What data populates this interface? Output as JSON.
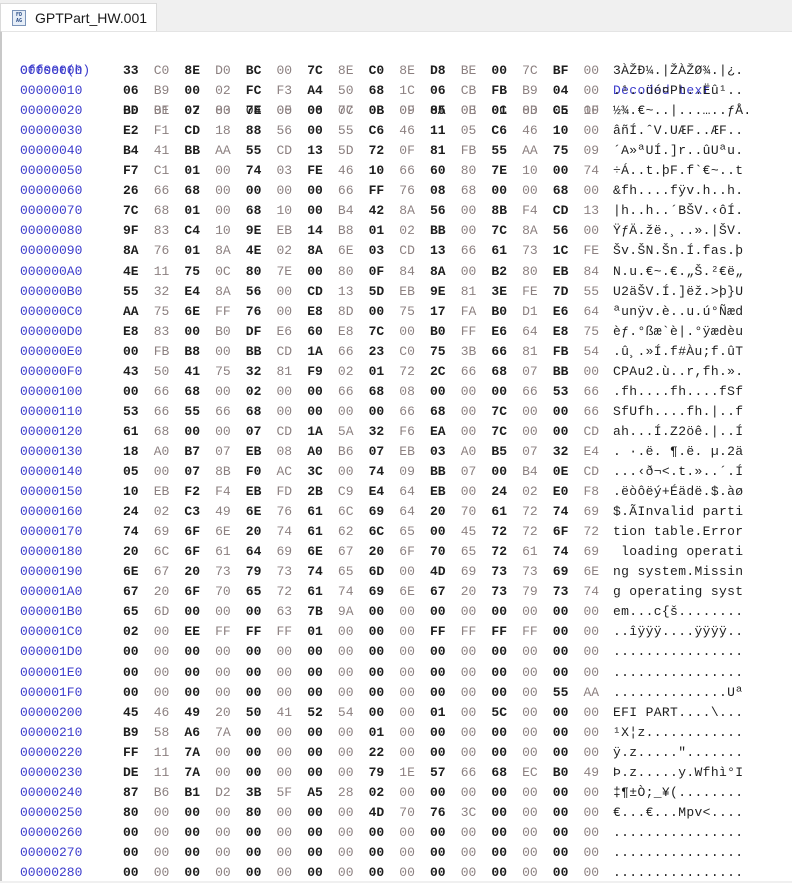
{
  "tab": {
    "title": "GPTPart_HW.001",
    "icon": "hex-file-icon",
    "icon_text": "FD AG"
  },
  "header": {
    "offset_label": "Offset(h)",
    "columns": [
      "00",
      "01",
      "02",
      "03",
      "04",
      "05",
      "06",
      "07",
      "08",
      "09",
      "0A",
      "0B",
      "0C",
      "0D",
      "0E",
      "0F"
    ],
    "decoded_label": "Decoded text"
  },
  "colors": {
    "offset": "#3c3ccc",
    "byte_even": "#1e1e1e",
    "byte_odd": "#8c8080"
  },
  "rows": [
    {
      "offset": "00000000",
      "bytes": [
        "33",
        "C0",
        "8E",
        "D0",
        "BC",
        "00",
        "7C",
        "8E",
        "C0",
        "8E",
        "D8",
        "BE",
        "00",
        "7C",
        "BF",
        "00"
      ],
      "text": "3ÀŽÐ¼.|ŽÀŽØ¾.|¿."
    },
    {
      "offset": "00000010",
      "bytes": [
        "06",
        "B9",
        "00",
        "02",
        "FC",
        "F3",
        "A4",
        "50",
        "68",
        "1C",
        "06",
        "CB",
        "FB",
        "B9",
        "04",
        "00"
      ],
      "text": ".¹..üó¤Ph..Ëû¹.."
    },
    {
      "offset": "00000020",
      "bytes": [
        "BD",
        "BE",
        "07",
        "80",
        "7E",
        "00",
        "00",
        "7C",
        "0B",
        "0F",
        "85",
        "0E",
        "01",
        "83",
        "C5",
        "10"
      ],
      "text": "½¾.€~..|...…..ƒÅ."
    },
    {
      "offset": "00000030",
      "bytes": [
        "E2",
        "F1",
        "CD",
        "18",
        "88",
        "56",
        "00",
        "55",
        "C6",
        "46",
        "11",
        "05",
        "C6",
        "46",
        "10",
        "00"
      ],
      "text": "âñÍ.ˆV.UÆF..ÆF.."
    },
    {
      "offset": "00000040",
      "bytes": [
        "B4",
        "41",
        "BB",
        "AA",
        "55",
        "CD",
        "13",
        "5D",
        "72",
        "0F",
        "81",
        "FB",
        "55",
        "AA",
        "75",
        "09"
      ],
      "text": "´A»ªUÍ.]r..ûUªu."
    },
    {
      "offset": "00000050",
      "bytes": [
        "F7",
        "C1",
        "01",
        "00",
        "74",
        "03",
        "FE",
        "46",
        "10",
        "66",
        "60",
        "80",
        "7E",
        "10",
        "00",
        "74"
      ],
      "text": "÷Á..t.þF.f`€~..t"
    },
    {
      "offset": "00000060",
      "bytes": [
        "26",
        "66",
        "68",
        "00",
        "00",
        "00",
        "00",
        "66",
        "FF",
        "76",
        "08",
        "68",
        "00",
        "00",
        "68",
        "00"
      ],
      "text": "&fh....fÿv.h..h."
    },
    {
      "offset": "00000070",
      "bytes": [
        "7C",
        "68",
        "01",
        "00",
        "68",
        "10",
        "00",
        "B4",
        "42",
        "8A",
        "56",
        "00",
        "8B",
        "F4",
        "CD",
        "13"
      ],
      "text": "|h..h..´BŠV.‹ôÍ."
    },
    {
      "offset": "00000080",
      "bytes": [
        "9F",
        "83",
        "C4",
        "10",
        "9E",
        "EB",
        "14",
        "B8",
        "01",
        "02",
        "BB",
        "00",
        "7C",
        "8A",
        "56",
        "00"
      ],
      "text": "ŸƒÄ.žë.¸..».|ŠV."
    },
    {
      "offset": "00000090",
      "bytes": [
        "8A",
        "76",
        "01",
        "8A",
        "4E",
        "02",
        "8A",
        "6E",
        "03",
        "CD",
        "13",
        "66",
        "61",
        "73",
        "1C",
        "FE"
      ],
      "text": "Šv.ŠN.Šn.Í.fas.þ"
    },
    {
      "offset": "000000A0",
      "bytes": [
        "4E",
        "11",
        "75",
        "0C",
        "80",
        "7E",
        "00",
        "80",
        "0F",
        "84",
        "8A",
        "00",
        "B2",
        "80",
        "EB",
        "84"
      ],
      "text": "N.u.€~.€.„Š.²€ë„"
    },
    {
      "offset": "000000B0",
      "bytes": [
        "55",
        "32",
        "E4",
        "8A",
        "56",
        "00",
        "CD",
        "13",
        "5D",
        "EB",
        "9E",
        "81",
        "3E",
        "FE",
        "7D",
        "55"
      ],
      "text": "U2äŠV.Í.]ëž.>þ}U"
    },
    {
      "offset": "000000C0",
      "bytes": [
        "AA",
        "75",
        "6E",
        "FF",
        "76",
        "00",
        "E8",
        "8D",
        "00",
        "75",
        "17",
        "FA",
        "B0",
        "D1",
        "E6",
        "64"
      ],
      "text": "ªunÿv.è..u.ú°Ñæd"
    },
    {
      "offset": "000000D0",
      "bytes": [
        "E8",
        "83",
        "00",
        "B0",
        "DF",
        "E6",
        "60",
        "E8",
        "7C",
        "00",
        "B0",
        "FF",
        "E6",
        "64",
        "E8",
        "75"
      ],
      "text": "èƒ.°ßæ`è|.°ÿædèu"
    },
    {
      "offset": "000000E0",
      "bytes": [
        "00",
        "FB",
        "B8",
        "00",
        "BB",
        "CD",
        "1A",
        "66",
        "23",
        "C0",
        "75",
        "3B",
        "66",
        "81",
        "FB",
        "54"
      ],
      "text": ".û¸.»Í.f#Àu;f.ûT"
    },
    {
      "offset": "000000F0",
      "bytes": [
        "43",
        "50",
        "41",
        "75",
        "32",
        "81",
        "F9",
        "02",
        "01",
        "72",
        "2C",
        "66",
        "68",
        "07",
        "BB",
        "00"
      ],
      "text": "CPAu2.ù..r,fh.»."
    },
    {
      "offset": "00000100",
      "bytes": [
        "00",
        "66",
        "68",
        "00",
        "02",
        "00",
        "00",
        "66",
        "68",
        "08",
        "00",
        "00",
        "00",
        "66",
        "53",
        "66"
      ],
      "text": ".fh....fh....fSf"
    },
    {
      "offset": "00000110",
      "bytes": [
        "53",
        "66",
        "55",
        "66",
        "68",
        "00",
        "00",
        "00",
        "00",
        "66",
        "68",
        "00",
        "7C",
        "00",
        "00",
        "66"
      ],
      "text": "SfUfh....fh.|..f"
    },
    {
      "offset": "00000120",
      "bytes": [
        "61",
        "68",
        "00",
        "00",
        "07",
        "CD",
        "1A",
        "5A",
        "32",
        "F6",
        "EA",
        "00",
        "7C",
        "00",
        "00",
        "CD"
      ],
      "text": "ah...Í.Z2öê.|..Í"
    },
    {
      "offset": "00000130",
      "bytes": [
        "18",
        "A0",
        "B7",
        "07",
        "EB",
        "08",
        "A0",
        "B6",
        "07",
        "EB",
        "03",
        "A0",
        "B5",
        "07",
        "32",
        "E4"
      ],
      "text": ". ·.ë. ¶.ë. µ.2ä"
    },
    {
      "offset": "00000140",
      "bytes": [
        "05",
        "00",
        "07",
        "8B",
        "F0",
        "AC",
        "3C",
        "00",
        "74",
        "09",
        "BB",
        "07",
        "00",
        "B4",
        "0E",
        "CD"
      ],
      "text": "...‹ð¬<.t.»..´.Í"
    },
    {
      "offset": "00000150",
      "bytes": [
        "10",
        "EB",
        "F2",
        "F4",
        "EB",
        "FD",
        "2B",
        "C9",
        "E4",
        "64",
        "EB",
        "00",
        "24",
        "02",
        "E0",
        "F8"
      ],
      "text": ".ëòôëý+Éädë.$.àø"
    },
    {
      "offset": "00000160",
      "bytes": [
        "24",
        "02",
        "C3",
        "49",
        "6E",
        "76",
        "61",
        "6C",
        "69",
        "64",
        "20",
        "70",
        "61",
        "72",
        "74",
        "69"
      ],
      "text": "$.ÃInvalid parti"
    },
    {
      "offset": "00000170",
      "bytes": [
        "74",
        "69",
        "6F",
        "6E",
        "20",
        "74",
        "61",
        "62",
        "6C",
        "65",
        "00",
        "45",
        "72",
        "72",
        "6F",
        "72"
      ],
      "text": "tion table.Error"
    },
    {
      "offset": "00000180",
      "bytes": [
        "20",
        "6C",
        "6F",
        "61",
        "64",
        "69",
        "6E",
        "67",
        "20",
        "6F",
        "70",
        "65",
        "72",
        "61",
        "74",
        "69"
      ],
      "text": " loading operati"
    },
    {
      "offset": "00000190",
      "bytes": [
        "6E",
        "67",
        "20",
        "73",
        "79",
        "73",
        "74",
        "65",
        "6D",
        "00",
        "4D",
        "69",
        "73",
        "73",
        "69",
        "6E"
      ],
      "text": "ng system.Missin"
    },
    {
      "offset": "000001A0",
      "bytes": [
        "67",
        "20",
        "6F",
        "70",
        "65",
        "72",
        "61",
        "74",
        "69",
        "6E",
        "67",
        "20",
        "73",
        "79",
        "73",
        "74"
      ],
      "text": "g operating syst"
    },
    {
      "offset": "000001B0",
      "bytes": [
        "65",
        "6D",
        "00",
        "00",
        "00",
        "63",
        "7B",
        "9A",
        "00",
        "00",
        "00",
        "00",
        "00",
        "00",
        "00",
        "00"
      ],
      "text": "em...c{š........"
    },
    {
      "offset": "000001C0",
      "bytes": [
        "02",
        "00",
        "EE",
        "FF",
        "FF",
        "FF",
        "01",
        "00",
        "00",
        "00",
        "FF",
        "FF",
        "FF",
        "FF",
        "00",
        "00"
      ],
      "text": "..îÿÿÿ....ÿÿÿÿ.."
    },
    {
      "offset": "000001D0",
      "bytes": [
        "00",
        "00",
        "00",
        "00",
        "00",
        "00",
        "00",
        "00",
        "00",
        "00",
        "00",
        "00",
        "00",
        "00",
        "00",
        "00"
      ],
      "text": "................"
    },
    {
      "offset": "000001E0",
      "bytes": [
        "00",
        "00",
        "00",
        "00",
        "00",
        "00",
        "00",
        "00",
        "00",
        "00",
        "00",
        "00",
        "00",
        "00",
        "00",
        "00"
      ],
      "text": "................"
    },
    {
      "offset": "000001F0",
      "bytes": [
        "00",
        "00",
        "00",
        "00",
        "00",
        "00",
        "00",
        "00",
        "00",
        "00",
        "00",
        "00",
        "00",
        "00",
        "55",
        "AA"
      ],
      "text": "..............Uª"
    },
    {
      "offset": "00000200",
      "bytes": [
        "45",
        "46",
        "49",
        "20",
        "50",
        "41",
        "52",
        "54",
        "00",
        "00",
        "01",
        "00",
        "5C",
        "00",
        "00",
        "00"
      ],
      "text": "EFI PART....\\..."
    },
    {
      "offset": "00000210",
      "bytes": [
        "B9",
        "58",
        "A6",
        "7A",
        "00",
        "00",
        "00",
        "00",
        "01",
        "00",
        "00",
        "00",
        "00",
        "00",
        "00",
        "00"
      ],
      "text": "¹X¦z............"
    },
    {
      "offset": "00000220",
      "bytes": [
        "FF",
        "11",
        "7A",
        "00",
        "00",
        "00",
        "00",
        "00",
        "22",
        "00",
        "00",
        "00",
        "00",
        "00",
        "00",
        "00"
      ],
      "text": "ÿ.z.....\"......."
    },
    {
      "offset": "00000230",
      "bytes": [
        "DE",
        "11",
        "7A",
        "00",
        "00",
        "00",
        "00",
        "00",
        "79",
        "1E",
        "57",
        "66",
        "68",
        "EC",
        "B0",
        "49"
      ],
      "text": "Þ.z.....y.Wfhì°I"
    },
    {
      "offset": "00000240",
      "bytes": [
        "87",
        "B6",
        "B1",
        "D2",
        "3B",
        "5F",
        "A5",
        "28",
        "02",
        "00",
        "00",
        "00",
        "00",
        "00",
        "00",
        "00"
      ],
      "text": "‡¶±Ò;_¥(........"
    },
    {
      "offset": "00000250",
      "bytes": [
        "80",
        "00",
        "00",
        "00",
        "80",
        "00",
        "00",
        "00",
        "4D",
        "70",
        "76",
        "3C",
        "00",
        "00",
        "00",
        "00"
      ],
      "text": "€...€...Mpv<...."
    },
    {
      "offset": "00000260",
      "bytes": [
        "00",
        "00",
        "00",
        "00",
        "00",
        "00",
        "00",
        "00",
        "00",
        "00",
        "00",
        "00",
        "00",
        "00",
        "00",
        "00"
      ],
      "text": "................"
    },
    {
      "offset": "00000270",
      "bytes": [
        "00",
        "00",
        "00",
        "00",
        "00",
        "00",
        "00",
        "00",
        "00",
        "00",
        "00",
        "00",
        "00",
        "00",
        "00",
        "00"
      ],
      "text": "................"
    },
    {
      "offset": "00000280",
      "bytes": [
        "00",
        "00",
        "00",
        "00",
        "00",
        "00",
        "00",
        "00",
        "00",
        "00",
        "00",
        "00",
        "00",
        "00",
        "00",
        "00"
      ],
      "text": "................"
    }
  ]
}
